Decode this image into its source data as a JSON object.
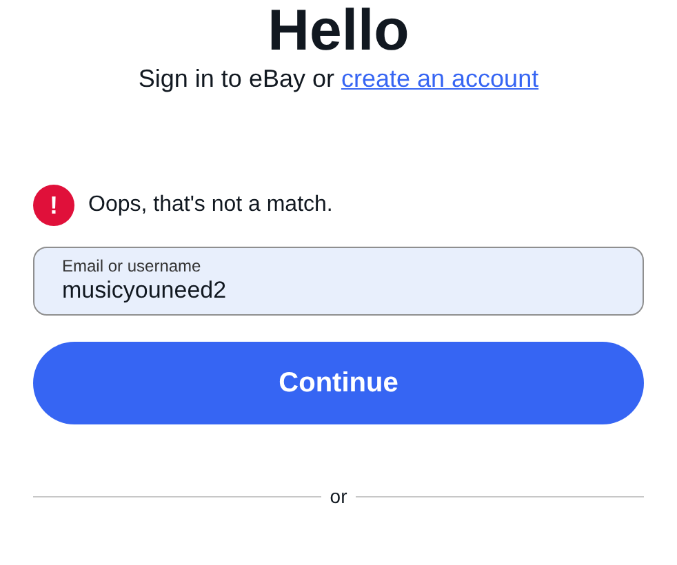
{
  "heading": "Hello",
  "subtitle": {
    "text": "Sign in to eBay or",
    "link": "create an account"
  },
  "error": {
    "icon": "!",
    "message": "Oops, that's not a match."
  },
  "field": {
    "label": "Email or username",
    "value": "musicyouneed2",
    "invalid": false
  },
  "button": "Continue",
  "divider": "or"
}
